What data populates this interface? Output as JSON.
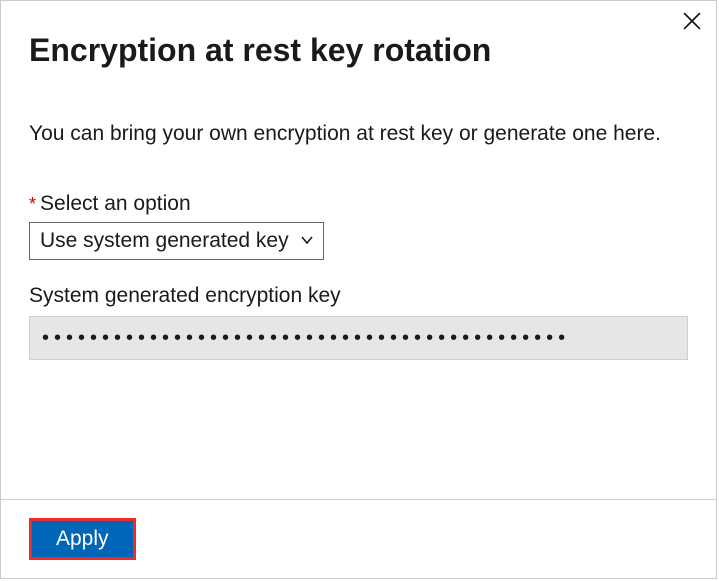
{
  "dialog": {
    "title": "Encryption at rest key rotation",
    "description": "You can bring your own encryption at rest key or generate one here.",
    "option_label": "Select an option",
    "option_selected": "Use system generated key",
    "key_label": "System generated encryption key",
    "key_masked": "••••••••••••••••••••••••••••••••••••••••••••",
    "apply_label": "Apply"
  }
}
